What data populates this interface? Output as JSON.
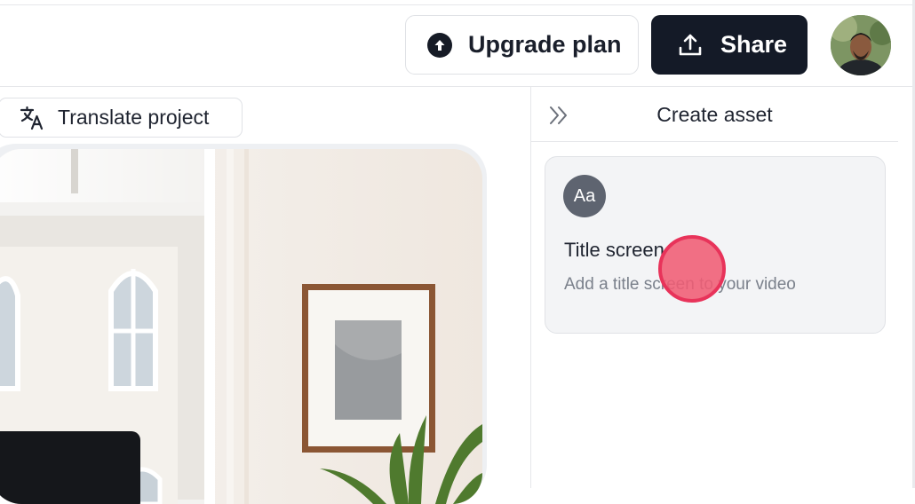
{
  "topbar": {
    "upgrade_label": "Upgrade plan",
    "share_label": "Share"
  },
  "editor": {
    "translate_label": "Translate project"
  },
  "panel": {
    "title": "Create asset",
    "card": {
      "badge": "Aa",
      "title": "Title screen",
      "description": "Add a title screen to your video"
    }
  },
  "colors": {
    "primary_dark": "#141a27",
    "cursor_highlight": "#e8335a",
    "card_bg": "#f3f4f6"
  },
  "icons": {
    "upgrade": "arrow-up-circle-icon",
    "share": "upload-icon",
    "translate": "translate-icon",
    "collapse": "double-chevron-right-icon"
  }
}
